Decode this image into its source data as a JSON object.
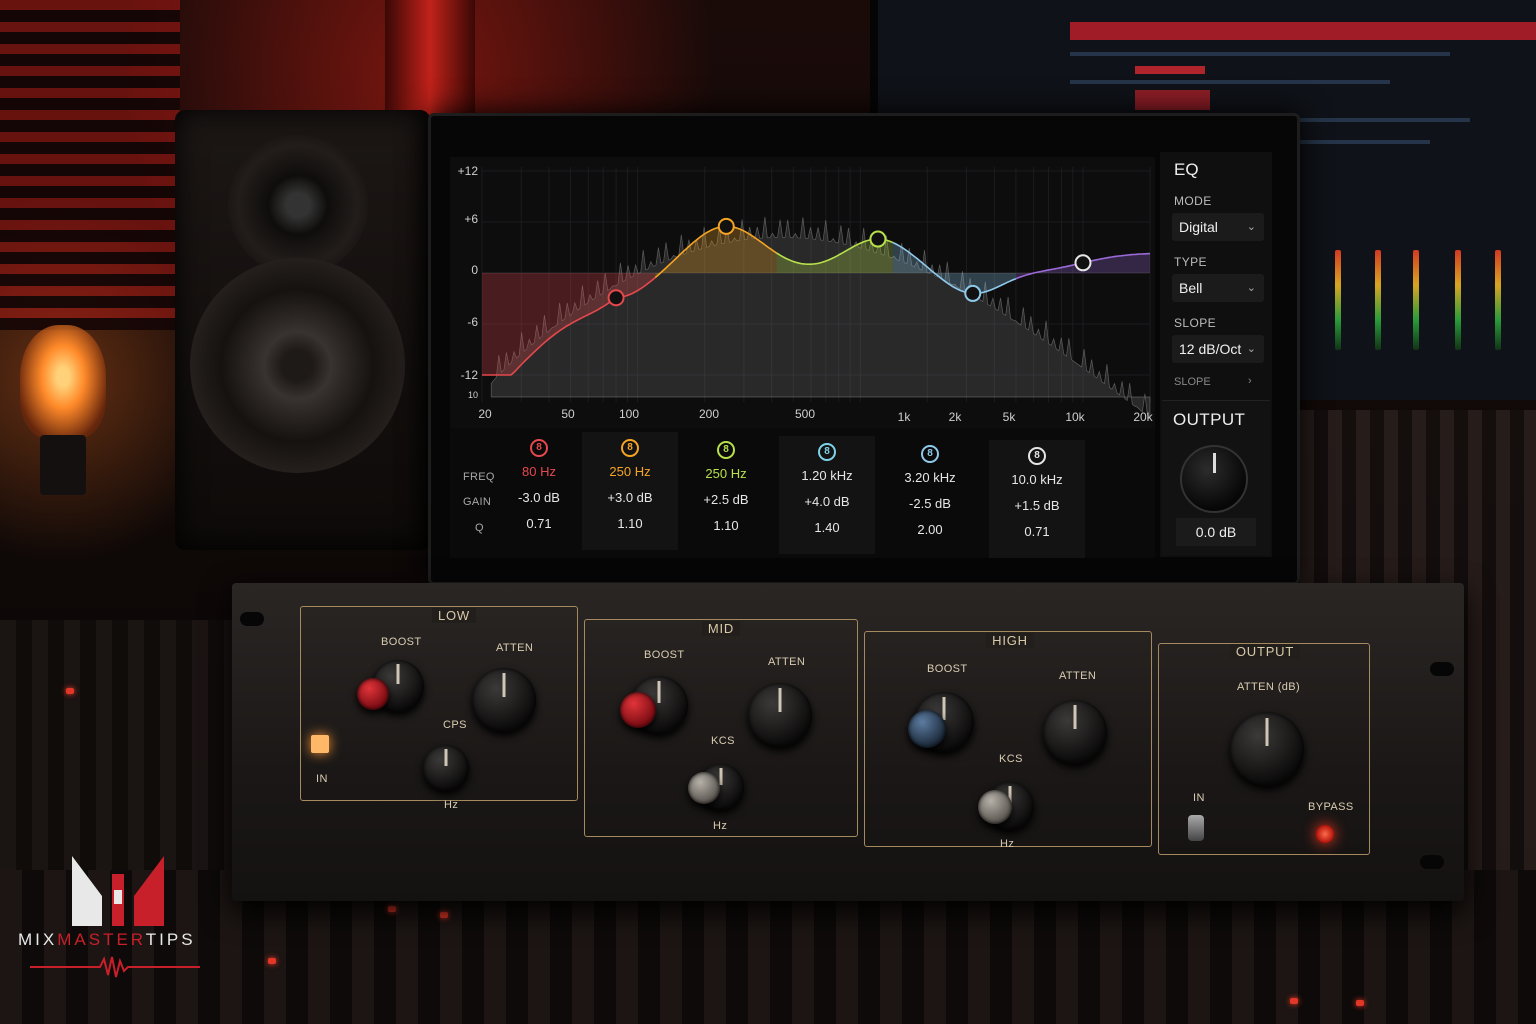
{
  "eq": {
    "title": "EQ",
    "y_axis": [
      "+12",
      "+6",
      "0",
      "-6",
      "-12"
    ],
    "y_axis_bottom": "10",
    "x_axis": [
      "20",
      "50",
      "100",
      "200",
      "500",
      "1k",
      "2k",
      "5k",
      "10k",
      "20k"
    ],
    "row_labels": {
      "freq": "FREQ",
      "gain": "GAIN",
      "q": "Q"
    },
    "bands": [
      {
        "number": "8",
        "color": "#e5484d",
        "freq": "80 Hz",
        "gain": "-3.0 dB",
        "q": "0.71"
      },
      {
        "number": "8",
        "color": "#f5a524",
        "freq": "250 Hz",
        "gain": "+3.0 dB",
        "q": "1.10"
      },
      {
        "number": "8",
        "color": "#b7e04a",
        "freq": "250 Hz",
        "gain": "+2.5 dB",
        "q": "1.10"
      },
      {
        "number": "8",
        "color": "#7fd3e8",
        "freq": "1.20 kHz",
        "gain": "+4.0 dB",
        "q": "1.40"
      },
      {
        "number": "8",
        "color": "#8fc9ea",
        "freq": "3.20 kHz",
        "gain": "-2.5 dB",
        "q": "2.00"
      },
      {
        "number": "8",
        "color": "#e6e6e6",
        "freq": "10.0 kHz",
        "gain": "+1.5 dB",
        "q": "0.71"
      }
    ],
    "side_panel": {
      "mode_label": "MODE",
      "mode_value": "Digital",
      "type_label": "TYPE",
      "type_value": "Bell",
      "slope_label": "SLOPE",
      "slope_value": "12 dB/Oct",
      "more_label": "SLOPE"
    },
    "output": {
      "title": "OUTPUT",
      "value": "0.0 dB"
    }
  },
  "hardware": {
    "sections": {
      "low": {
        "title": "LOW",
        "boost": "BOOST",
        "atten": "ATTEN",
        "cps": "CPS",
        "hz": "Hz",
        "in": "IN"
      },
      "mid": {
        "title": "MID",
        "boost": "BOOST",
        "atten": "ATTEN",
        "kcs": "KCS",
        "hz": "Hz"
      },
      "high": {
        "title": "HIGH",
        "boost": "BOOST",
        "atten": "ATTEN",
        "kcs": "KCS",
        "hz": "Hz"
      },
      "output": {
        "title": "OUTPUT",
        "atten": "ATTEN (dB)",
        "in": "IN",
        "bypass": "BYPASS"
      }
    }
  },
  "logo": {
    "mix": "MIX",
    "master": "MASTER",
    "tips": "TIPS",
    "accent": "#c8202a"
  }
}
